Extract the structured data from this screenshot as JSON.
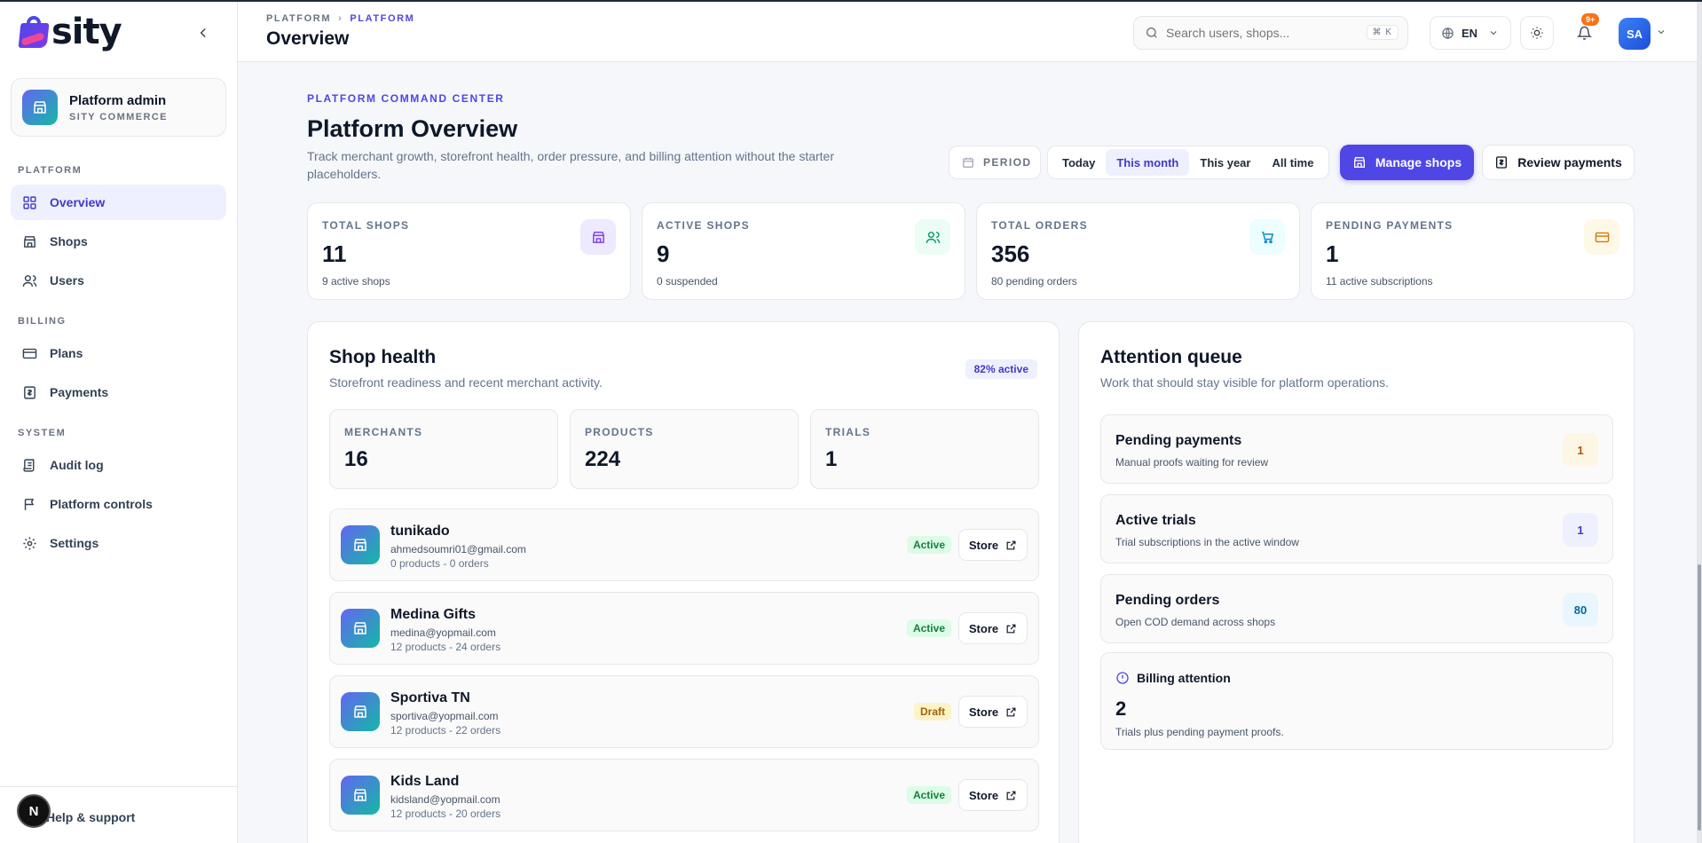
{
  "brand": {
    "name": "sity"
  },
  "account": {
    "name": "Platform admin",
    "org": "SITY COMMERCE"
  },
  "sidebar": {
    "sections": [
      {
        "label": "PLATFORM",
        "items": [
          {
            "label": "Overview",
            "icon": "grid-icon",
            "active": true
          },
          {
            "label": "Shops",
            "icon": "store-icon"
          },
          {
            "label": "Users",
            "icon": "users-icon"
          }
        ]
      },
      {
        "label": "BILLING",
        "items": [
          {
            "label": "Plans",
            "icon": "card-icon"
          },
          {
            "label": "Payments",
            "icon": "receipt-icon"
          }
        ]
      },
      {
        "label": "SYSTEM",
        "items": [
          {
            "label": "Audit log",
            "icon": "scroll-icon"
          },
          {
            "label": "Platform controls",
            "icon": "flag-icon"
          },
          {
            "label": "Settings",
            "icon": "gear-icon"
          }
        ]
      }
    ],
    "help": "Help & support",
    "dev_badge": "N"
  },
  "header": {
    "breadcrumb": [
      "PLATFORM",
      "PLATFORM"
    ],
    "title": "Overview",
    "search_placeholder": "Search users, shops...",
    "search_shortcut": "⌘ K",
    "language": "EN",
    "notifications": "9+",
    "avatar_initials": "SA"
  },
  "hero": {
    "eyebrow": "PLATFORM COMMAND CENTER",
    "title": "Platform Overview",
    "description": "Track merchant growth, storefront health, order pressure, and billing attention without the starter placeholders.",
    "period_label": "PERIOD",
    "periods": [
      "Today",
      "This month",
      "This year",
      "All time"
    ],
    "selected_period": "This month",
    "primary_action": "Manage shops",
    "secondary_action": "Review payments"
  },
  "stats": [
    {
      "label": "TOTAL SHOPS",
      "value": "11",
      "sub": "9 active shops",
      "icon": "store-icon",
      "tint": "#ede9fe",
      "color": "#7c3aed"
    },
    {
      "label": "ACTIVE SHOPS",
      "value": "9",
      "sub": "0 suspended",
      "icon": "users-icon",
      "tint": "#ecfdf5",
      "color": "#059669"
    },
    {
      "label": "TOTAL ORDERS",
      "value": "356",
      "sub": "80 pending orders",
      "icon": "cart-icon",
      "tint": "#ecfeff",
      "color": "#0284c7"
    },
    {
      "label": "PENDING PAYMENTS",
      "value": "1",
      "sub": "11 active subscriptions",
      "icon": "card-icon",
      "tint": "#fef9e7",
      "color": "#d97706"
    }
  ],
  "shop_health": {
    "title": "Shop health",
    "subtitle": "Storefront readiness and recent merchant activity.",
    "badge": "82% active",
    "metrics": [
      {
        "label": "MERCHANTS",
        "value": "16"
      },
      {
        "label": "PRODUCTS",
        "value": "224"
      },
      {
        "label": "TRIALS",
        "value": "1"
      }
    ],
    "shops": [
      {
        "name": "tunikado",
        "email": "ahmedsoumri01@gmail.com",
        "meta": "0 products - 0 orders",
        "status": "Active",
        "action": "Store"
      },
      {
        "name": "Medina Gifts",
        "email": "medina@yopmail.com",
        "meta": "12 products - 24 orders",
        "status": "Active",
        "action": "Store"
      },
      {
        "name": "Sportiva TN",
        "email": "sportiva@yopmail.com",
        "meta": "12 products - 22 orders",
        "status": "Draft",
        "action": "Store"
      },
      {
        "name": "Kids Land",
        "email": "kidsland@yopmail.com",
        "meta": "12 products - 20 orders",
        "status": "Active",
        "action": "Store"
      }
    ]
  },
  "attention": {
    "title": "Attention queue",
    "subtitle": "Work that should stay visible for platform operations.",
    "items": [
      {
        "title": "Pending payments",
        "sub": "Manual proofs waiting for review",
        "count": "1",
        "bg": "#fef6e4",
        "fg": "#b45309"
      },
      {
        "title": "Active trials",
        "sub": "Trial subscriptions in the active window",
        "count": "1",
        "bg": "#eef0ff",
        "fg": "#4338ca"
      },
      {
        "title": "Pending orders",
        "sub": "Open COD demand across shops",
        "count": "80",
        "bg": "#eaf6ff",
        "fg": "#0369a1"
      }
    ],
    "billing": {
      "title": "Billing attention",
      "value": "2",
      "sub": "Trials plus pending payment proofs."
    }
  }
}
